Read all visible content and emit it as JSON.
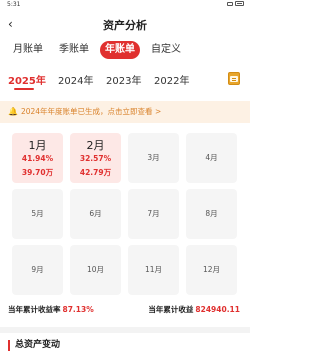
{
  "status_bar": {
    "time": "5:31"
  },
  "header": {
    "title": "资产分析",
    "back_icon": "back-arrow-icon"
  },
  "tabs": [
    {
      "label": "月账单",
      "active": false
    },
    {
      "label": "季账单",
      "active": false
    },
    {
      "label": "年账单",
      "active": true
    },
    {
      "label": "自定义",
      "active": false
    }
  ],
  "years": [
    {
      "label": "2025年",
      "active": true
    },
    {
      "label": "2024年",
      "active": false
    },
    {
      "label": "2023年",
      "active": false
    },
    {
      "label": "2022年",
      "active": false
    }
  ],
  "notice": {
    "text": "2024年年度账单已生成，点击立即查看 >"
  },
  "months": [
    {
      "label": "1月",
      "pct": "41.94%",
      "amount": "39.70万",
      "filled": true
    },
    {
      "label": "2月",
      "pct": "32.57%",
      "amount": "42.79万",
      "filled": true
    },
    {
      "label": "3月"
    },
    {
      "label": "4月"
    },
    {
      "label": "5月"
    },
    {
      "label": "6月"
    },
    {
      "label": "7月"
    },
    {
      "label": "8月"
    },
    {
      "label": "9月"
    },
    {
      "label": "10月"
    },
    {
      "label": "11月"
    },
    {
      "label": "12月"
    }
  ],
  "summary": {
    "rate_label": "当年累计收益率",
    "rate_value": "87.13%",
    "income_label": "当年累计收益",
    "income_value": "824940.11"
  },
  "section": {
    "title": "总资产变动"
  },
  "colors": {
    "accent": "#e0302f",
    "notice_bg": "#fdf1e4",
    "notice_text": "#d9822b"
  }
}
